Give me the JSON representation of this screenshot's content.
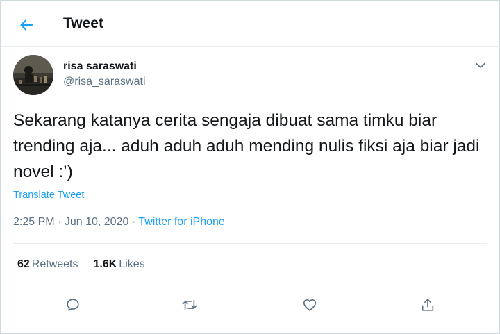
{
  "header": {
    "back_icon": "arrow-left-icon",
    "title": "Tweet"
  },
  "author": {
    "display_name": "risa saraswati",
    "handle": "@risa_saraswati",
    "avatar": "avatar-photo",
    "menu_icon": "chevron-down-icon"
  },
  "tweet": {
    "text": "Sekarang katanya cerita sengaja dibuat sama timku biar trending aja... aduh aduh aduh mending nulis fiksi aja biar jadi novel :’)",
    "translate_label": "Translate Tweet",
    "time": "2:25 PM",
    "separator": "·",
    "date": "Jun 10, 2020",
    "source": "Twitter for iPhone"
  },
  "stats": {
    "retweets_count": "62",
    "retweets_label": "Retweets",
    "likes_count": "1.6K",
    "likes_label": "Likes"
  },
  "actions": {
    "reply_icon": "reply-icon",
    "retweet_icon": "retweet-icon",
    "like_icon": "heart-icon",
    "share_icon": "share-icon"
  },
  "colors": {
    "accent": "#1da1f2",
    "text": "#14171a",
    "secondary": "#5b7083",
    "divider": "#e6ecf0"
  }
}
